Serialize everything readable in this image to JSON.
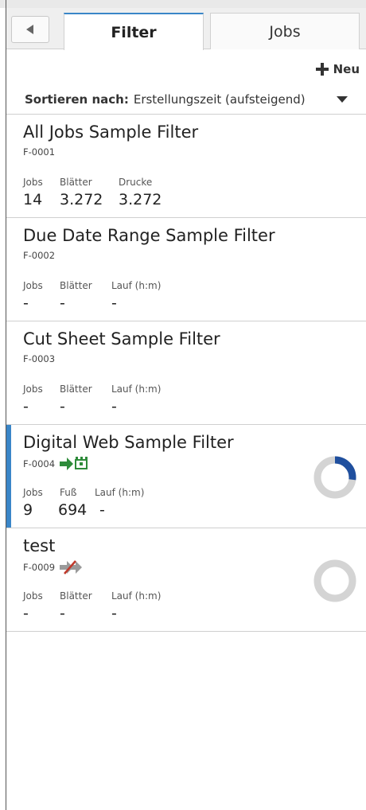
{
  "tabs": {
    "filter": "Filter",
    "jobs": "Jobs"
  },
  "toolbar": {
    "new_label": "Neu"
  },
  "sort": {
    "label": "Sortieren nach:",
    "value": "Erstellungszeit (aufsteigend)"
  },
  "colors": {
    "accent": "#3a86c8",
    "progress": "#1f4f9e",
    "ring": "#d4d4d4",
    "green": "#2e8b3a",
    "cross": "#c0392b"
  },
  "filters": [
    {
      "title": "All Jobs Sample Filter",
      "id": "F-0001",
      "labels": [
        "Jobs",
        "Blätter",
        "Drucke"
      ],
      "values": [
        "14",
        "3.272",
        "3.272"
      ]
    },
    {
      "title": "Due Date Range Sample Filter",
      "id": "F-0002",
      "labels": [
        "Jobs",
        "Blätter",
        "Lauf (h:m)"
      ],
      "values": [
        "-",
        "-",
        "-"
      ]
    },
    {
      "title": "Cut Sheet Sample Filter",
      "id": "F-0003",
      "labels": [
        "Jobs",
        "Blätter",
        "Lauf (h:m)"
      ],
      "values": [
        "-",
        "-",
        "-"
      ]
    },
    {
      "title": "Digital Web Sample Filter",
      "id": "F-0004",
      "labels": [
        "Jobs",
        "Fuß",
        "Lauf (h:m)"
      ],
      "values": [
        "9",
        "694",
        "-"
      ],
      "status_icon": "printer-connected-icon",
      "progress": 0.27
    },
    {
      "title": "test",
      "id": "F-0009",
      "labels": [
        "Jobs",
        "Blätter",
        "Lauf (h:m)"
      ],
      "values": [
        "-",
        "-",
        "-"
      ],
      "status_icon": "printer-disconnected-icon",
      "progress": 0
    }
  ]
}
